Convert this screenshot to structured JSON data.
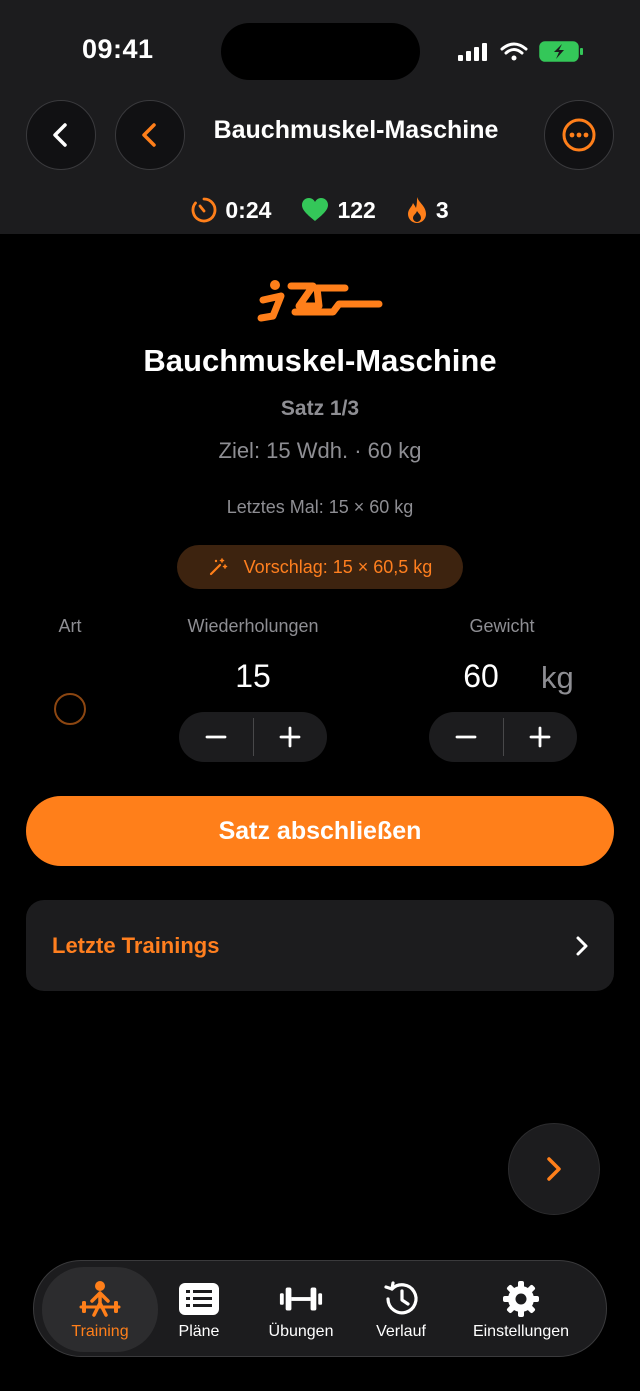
{
  "status_bar": {
    "time": "09:41"
  },
  "header": {
    "title": "Bauchmuskel-Maschine",
    "stats": [
      {
        "icon": "timer-icon",
        "value": "0:24"
      },
      {
        "icon": "heart-icon",
        "value": "122"
      },
      {
        "icon": "flame-icon",
        "value": "3"
      }
    ]
  },
  "exercise": {
    "icon": "ab-crunch-machine-icon",
    "name": "Bauchmuskel-Maschine",
    "set_label": "Satz 1/3",
    "target": "Ziel: 15 Wdh. · 60 kg",
    "last_time": "Letztes Mal: 15 × 60 kg",
    "suggestion": "Vorschlag: 15 × 60,5 kg"
  },
  "inputs": {
    "type_label": "Art",
    "reps_label": "Wiederholungen",
    "reps_value": "15",
    "weight_label": "Gewicht",
    "weight_value": "60",
    "weight_unit": "kg"
  },
  "actions": {
    "complete_set": "Satz abschließen",
    "recent_trainings": "Letzte Trainings"
  },
  "tabs": [
    {
      "label": "Training",
      "icon": "weightlifter-icon",
      "active": true
    },
    {
      "label": "Pläne",
      "icon": "list-icon",
      "active": false
    },
    {
      "label": "Übungen",
      "icon": "dumbbell-icon",
      "active": false
    },
    {
      "label": "Verlauf",
      "icon": "history-icon",
      "active": false
    },
    {
      "label": "Einstellungen",
      "icon": "gear-icon",
      "active": false
    }
  ],
  "colors": {
    "accent": "#ff7f1a",
    "background": "#000000",
    "surface": "#1c1c1e",
    "heart": "#34c759",
    "battery": "#34c759"
  }
}
